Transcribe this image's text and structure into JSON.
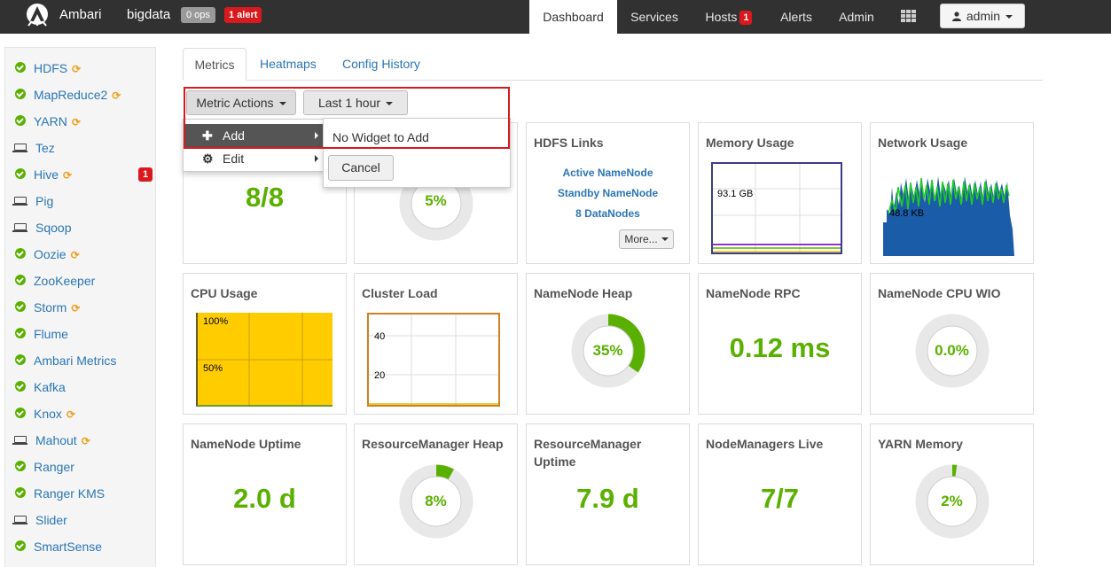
{
  "topbar": {
    "brand": "Ambari",
    "cluster": "bigdata",
    "ops": "0 ops",
    "alerts": "1 alert",
    "nav": {
      "dashboard": "Dashboard",
      "services": "Services",
      "hosts": "Hosts",
      "hosts_count": "1",
      "alerts": "Alerts",
      "admin": "Admin"
    },
    "user": "admin",
    "icons": [
      "ambari-logo-icon",
      "apps-grid-icon",
      "user-icon",
      "caret-down-icon"
    ]
  },
  "sidebar": {
    "services": [
      {
        "name": "HDFS",
        "status": "ok",
        "restart": true
      },
      {
        "name": "MapReduce2",
        "status": "ok",
        "restart": true
      },
      {
        "name": "YARN",
        "status": "ok",
        "restart": true
      },
      {
        "name": "Tez",
        "status": "client",
        "restart": false
      },
      {
        "name": "Hive",
        "status": "ok",
        "restart": true,
        "alerts": "1"
      },
      {
        "name": "Pig",
        "status": "client",
        "restart": false
      },
      {
        "name": "Sqoop",
        "status": "client",
        "restart": false
      },
      {
        "name": "Oozie",
        "status": "ok",
        "restart": true
      },
      {
        "name": "ZooKeeper",
        "status": "ok",
        "restart": false
      },
      {
        "name": "Storm",
        "status": "ok",
        "restart": true
      },
      {
        "name": "Flume",
        "status": "ok",
        "restart": false
      },
      {
        "name": "Ambari Metrics",
        "status": "ok",
        "restart": false
      },
      {
        "name": "Kafka",
        "status": "ok",
        "restart": false
      },
      {
        "name": "Knox",
        "status": "ok",
        "restart": true
      },
      {
        "name": "Mahout",
        "status": "client",
        "restart": true
      },
      {
        "name": "Ranger",
        "status": "ok",
        "restart": false
      },
      {
        "name": "Ranger KMS",
        "status": "ok",
        "restart": false
      },
      {
        "name": "Slider",
        "status": "client",
        "restart": false
      },
      {
        "name": "SmartSense",
        "status": "ok",
        "restart": false
      }
    ]
  },
  "tabs": {
    "metrics": "Metrics",
    "heatmaps": "Heatmaps",
    "config_history": "Config History"
  },
  "toolbar": {
    "metric_actions": "Metric Actions",
    "time_range": "Last 1 hour"
  },
  "metric_menu": {
    "add": "Add",
    "edit": "Edit",
    "no_widget": "No Widget to Add",
    "cancel": "Cancel"
  },
  "widgets": {
    "datanodes_live": {
      "value": "8/8"
    },
    "hdfs_disk": {
      "value": "5%",
      "fraction": 0.05
    },
    "hdfs_links": {
      "title": "HDFS Links",
      "links": [
        "Active NameNode",
        "Standby NameNode",
        "8 DataNodes"
      ],
      "more": "More..."
    },
    "memory_usage": {
      "title": "Memory Usage",
      "label": "93.1 GB"
    },
    "network_usage": {
      "title": "Network Usage",
      "label": "48.8 KB"
    },
    "cpu_usage": {
      "title": "CPU Usage",
      "labels": [
        "100%",
        "50%"
      ]
    },
    "cluster_load": {
      "title": "Cluster Load",
      "labels": [
        "40",
        "20"
      ]
    },
    "namenode_heap": {
      "title": "NameNode Heap",
      "value": "35%",
      "fraction": 0.35
    },
    "namenode_rpc": {
      "title": "NameNode RPC",
      "value": "0.12 ms"
    },
    "namenode_cpu_wio": {
      "title": "NameNode CPU WIO",
      "value": "0.0%",
      "fraction": 0.0
    },
    "namenode_uptime": {
      "title": "NameNode Uptime",
      "value": "2.0 d"
    },
    "rm_heap": {
      "title": "ResourceManager Heap",
      "value": "8%",
      "fraction": 0.08
    },
    "rm_uptime": {
      "title": "ResourceManager Uptime",
      "value": "7.9 d"
    },
    "nodemanagers_live": {
      "title": "NodeManagers Live",
      "value": "7/7"
    },
    "yarn_memory": {
      "title": "YARN Memory",
      "value": "2%",
      "fraction": 0.02
    }
  },
  "colors": {
    "topbar": "#313131",
    "link": "#2a76b6",
    "ok": "#5ab000",
    "alert": "#d9191d",
    "restart": "#f0a020",
    "highlight": "#d9191d"
  }
}
